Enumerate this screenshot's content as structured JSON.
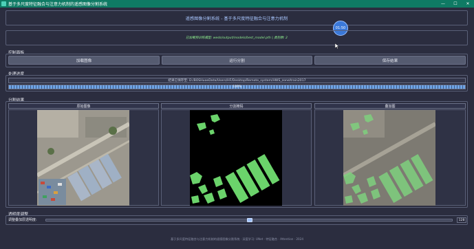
{
  "window": {
    "title": "基于多尺度特征融合与注意力机制的遥感图像分割系统",
    "minimize": "—",
    "maximize": "☐",
    "close": "✕"
  },
  "header": {
    "title": "遥感图像分割系统 - 基于多尺度特征融合与注意力机制"
  },
  "clock": {
    "time": "01:50"
  },
  "model": {
    "status": "已加载预训练模型: weds/output/models/best_model.pth | 类别数: 2"
  },
  "control_panel": {
    "label": "控制面板",
    "load_button": "加载图像",
    "run_button": "运行分割",
    "save_button": "保存结果"
  },
  "progress": {
    "label": "处理进度",
    "path_text": "结果已保存至: D:/BOSHuoeData/Users/HF/Desktop/Remote_system/HWS_zone/train2017",
    "percent_text": "100%",
    "value": 1.0
  },
  "results": {
    "label": "分割结果",
    "original_title": "原始图像",
    "mask_title": "分割掩码",
    "overlay_title": "叠加图"
  },
  "transparency": {
    "label": "透明度调整",
    "slider_label": "调整叠加层透明度:",
    "value_text": "128",
    "value": 128,
    "max": 255
  },
  "footer": {
    "text": "基于多尺度特征融合与注意力机制的遥感图像分割系统 · 深度学习: UNet · 特征融合 · Attention · 2024"
  },
  "colors": {
    "titlebar": "#0f7a64",
    "background": "#2b2d3f",
    "accent": "#3a78d8",
    "mask_fg": "#6bd36b",
    "progress": "#6fa4e6"
  }
}
